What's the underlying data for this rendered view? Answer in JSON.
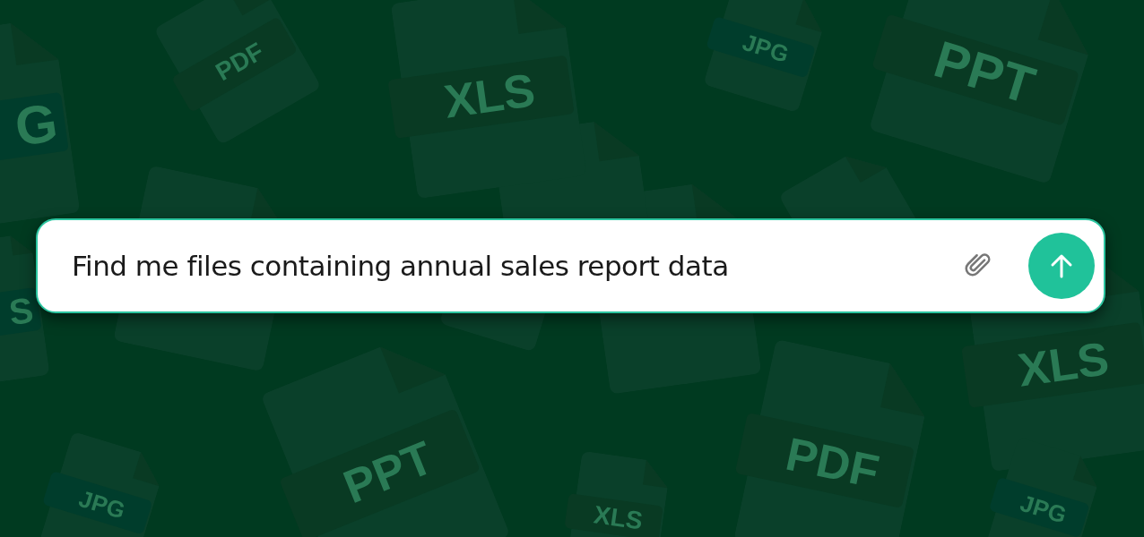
{
  "background_files": [
    {
      "label": "G"
    },
    {
      "label": "PDF"
    },
    {
      "label": "XLS"
    },
    {
      "label": "JPG"
    },
    {
      "label": "PPT"
    },
    {
      "label": "S"
    },
    {
      "label": "XLS"
    },
    {
      "label": "JPG"
    },
    {
      "label": "PPT"
    },
    {
      "label": "XLS"
    },
    {
      "label": "PDF"
    },
    {
      "label": "JPG"
    }
  ],
  "prompt": {
    "value": "Find me files containing annual sales report data"
  }
}
